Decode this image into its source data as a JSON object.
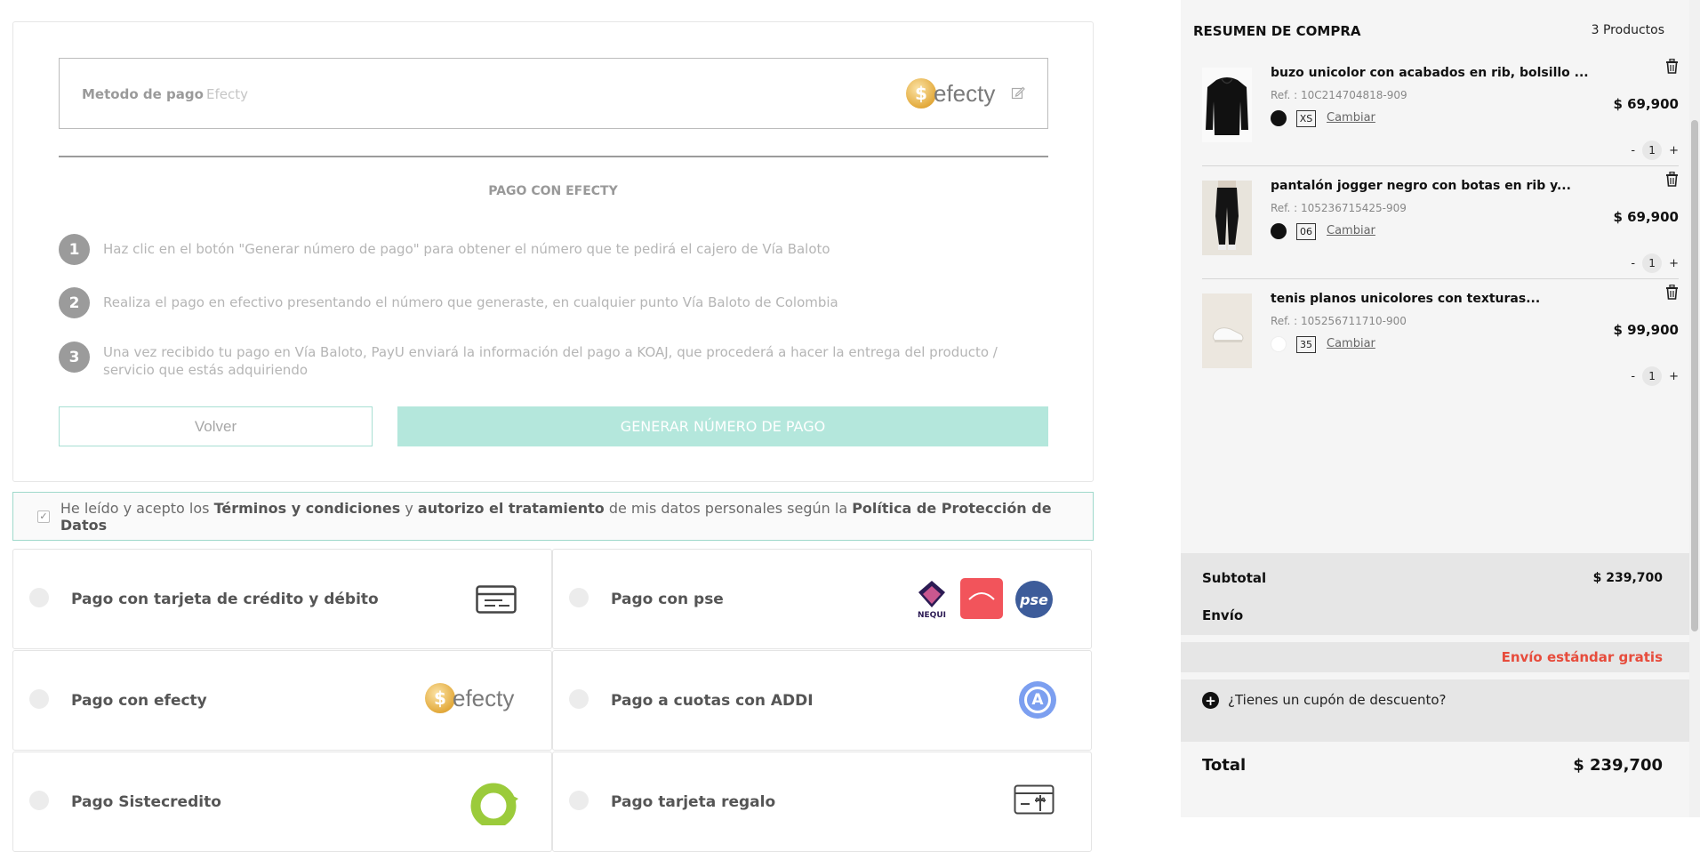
{
  "payment_form": {
    "method_label": "Metodo de pago",
    "method_value": "Efecty",
    "logo_coin": "$",
    "logo_text": "efecty",
    "section_title": "PAGO CON EFECTY",
    "steps": [
      {
        "num": "1",
        "text": "Haz clic en el botón \"Generar número de pago\" para obtener el número que te pedirá el cajero de Vía Baloto"
      },
      {
        "num": "2",
        "text": "Realiza el pago en efectivo presentando el número que generaste, en cualquier punto Vía Baloto de Colombia"
      },
      {
        "num": "3",
        "text": "Una vez recibido tu pago en Vía Baloto, PayU enviará la información del pago a KOAJ, que procederá a hacer la entrega del producto / servicio que estás adquiriendo"
      }
    ],
    "back_button": "Volver",
    "generate_button": "GENERAR NÚMERO DE PAGO"
  },
  "terms": {
    "t1": "He leído y acepto los ",
    "t2": "Términos y condiciones",
    "t3": " y ",
    "t4": "autorizo el tratamiento",
    "t5": " de mis datos personales según la ",
    "t6": "Política de Protección de Datos"
  },
  "payment_options": [
    {
      "label": "Pago con tarjeta de crédito y débito",
      "icon": "credit-card-icon"
    },
    {
      "label": "Pago con pse",
      "icon": "pse-logos",
      "logo_nequi": "NEQUI",
      "logo_pse": "pse"
    },
    {
      "label": "Pago con efecty",
      "icon": "efecty-logo"
    },
    {
      "label": "Pago a cuotas con ADDI",
      "icon": "addi-icon",
      "logo_addi": "A"
    },
    {
      "label": "Pago Sistecredito",
      "icon": "sistecredito-icon"
    },
    {
      "label": "Pago tarjeta regalo",
      "icon": "gift-card-icon"
    }
  ],
  "summary": {
    "title": "RESUMEN DE COMPRA",
    "count": "3 Productos",
    "items": [
      {
        "name": "buzo unicolor con acabados en rib, bolsillo ...",
        "ref": "Ref. : 10C214704818-909",
        "color": "#111111",
        "size": "XS",
        "change": "Cambiar",
        "price": "$ 69,900",
        "qty": "1",
        "minus": "-",
        "plus": "+"
      },
      {
        "name": "pantalón jogger negro con botas en rib y...",
        "ref": "Ref. : 105236715425-909",
        "color": "#111111",
        "size": "06",
        "change": "Cambiar",
        "price": "$ 69,900",
        "qty": "1",
        "minus": "-",
        "plus": "+"
      },
      {
        "name": "tenis planos unicolores con texturas...",
        "ref": "Ref. : 105256711710-900",
        "color": "#ffffff",
        "size": "35",
        "change": "Cambiar",
        "price": "$ 99,900",
        "qty": "1",
        "minus": "-",
        "plus": "+"
      }
    ],
    "subtotal_label": "Subtotal",
    "subtotal_value": "$ 239,700",
    "shipping_label": "Envío",
    "shipping_free": "Envío estándar gratis",
    "coupon_text": "¿Tienes un cupón de descuento?",
    "total_label": "Total",
    "total_value": "$ 239,700"
  },
  "colors": {
    "accent": "#b4e7dc",
    "accent_border": "#9fd9cb",
    "free_shipping": "#e74c3c"
  }
}
